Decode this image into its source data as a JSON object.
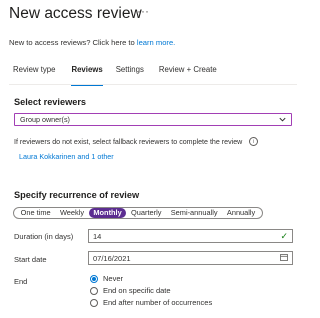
{
  "header": {
    "title": "New access review",
    "more_icon": "more-horizontal-icon"
  },
  "intro": {
    "text": "New to access reviews? Click here to",
    "link": "learn more."
  },
  "tabs": [
    {
      "label": "Review type"
    },
    {
      "label": "Reviews",
      "active": true
    },
    {
      "label": "Settings"
    },
    {
      "label": "Review + Create"
    }
  ],
  "reviewers": {
    "section_title": "Select reviewers",
    "dropdown_value": "Group owner(s)",
    "hint": "If reviewers do not exist, select fallback reviewers to complete the review",
    "fallback_link": "Laura Kokkarinen and 1 other"
  },
  "recurrence": {
    "section_title": "Specify recurrence of review",
    "options": [
      "One time",
      "Weekly",
      "Monthly",
      "Quarterly",
      "Semi-annually",
      "Annually"
    ],
    "selected": "Monthly",
    "duration_label": "Duration (in days)",
    "duration_value": "14",
    "start_label": "Start date",
    "start_value": "07/16/2021",
    "end_label": "End",
    "end_options": [
      "Never",
      "End on specific date",
      "End after number of occurrences"
    ],
    "end_selected": "Never"
  },
  "colors": {
    "accent": "#0078d4",
    "selected_pill": "#5c2d91",
    "dropdown_border": "#a23fb5",
    "valid": "#107c10"
  }
}
